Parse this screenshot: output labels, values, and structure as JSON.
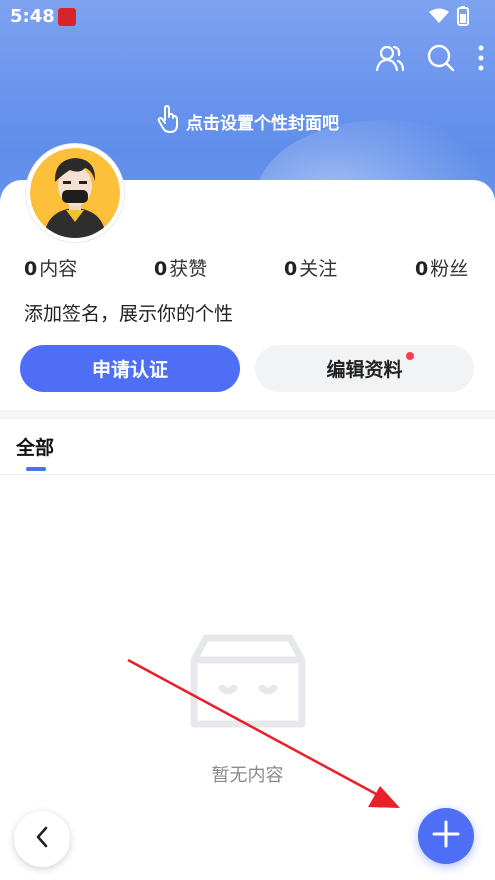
{
  "status_bar": {
    "time": "5:48"
  },
  "cover": {
    "hint": "点击设置个性封面吧"
  },
  "profile": {
    "stats": [
      {
        "count": "0",
        "label": "内容"
      },
      {
        "count": "0",
        "label": "获赞"
      },
      {
        "count": "0",
        "label": "关注"
      },
      {
        "count": "0",
        "label": "粉丝"
      }
    ],
    "bio_placeholder": "添加签名，展示你的个性",
    "apply_verify_label": "申请认证",
    "edit_profile_label": "编辑资料"
  },
  "tabs": [
    {
      "label": "全部",
      "selected": true
    }
  ],
  "empty_state": {
    "text": "暂无内容"
  },
  "colors": {
    "accent": "#4d6ef5",
    "badge": "#ff3b4e",
    "arrow": "#e8202a"
  }
}
